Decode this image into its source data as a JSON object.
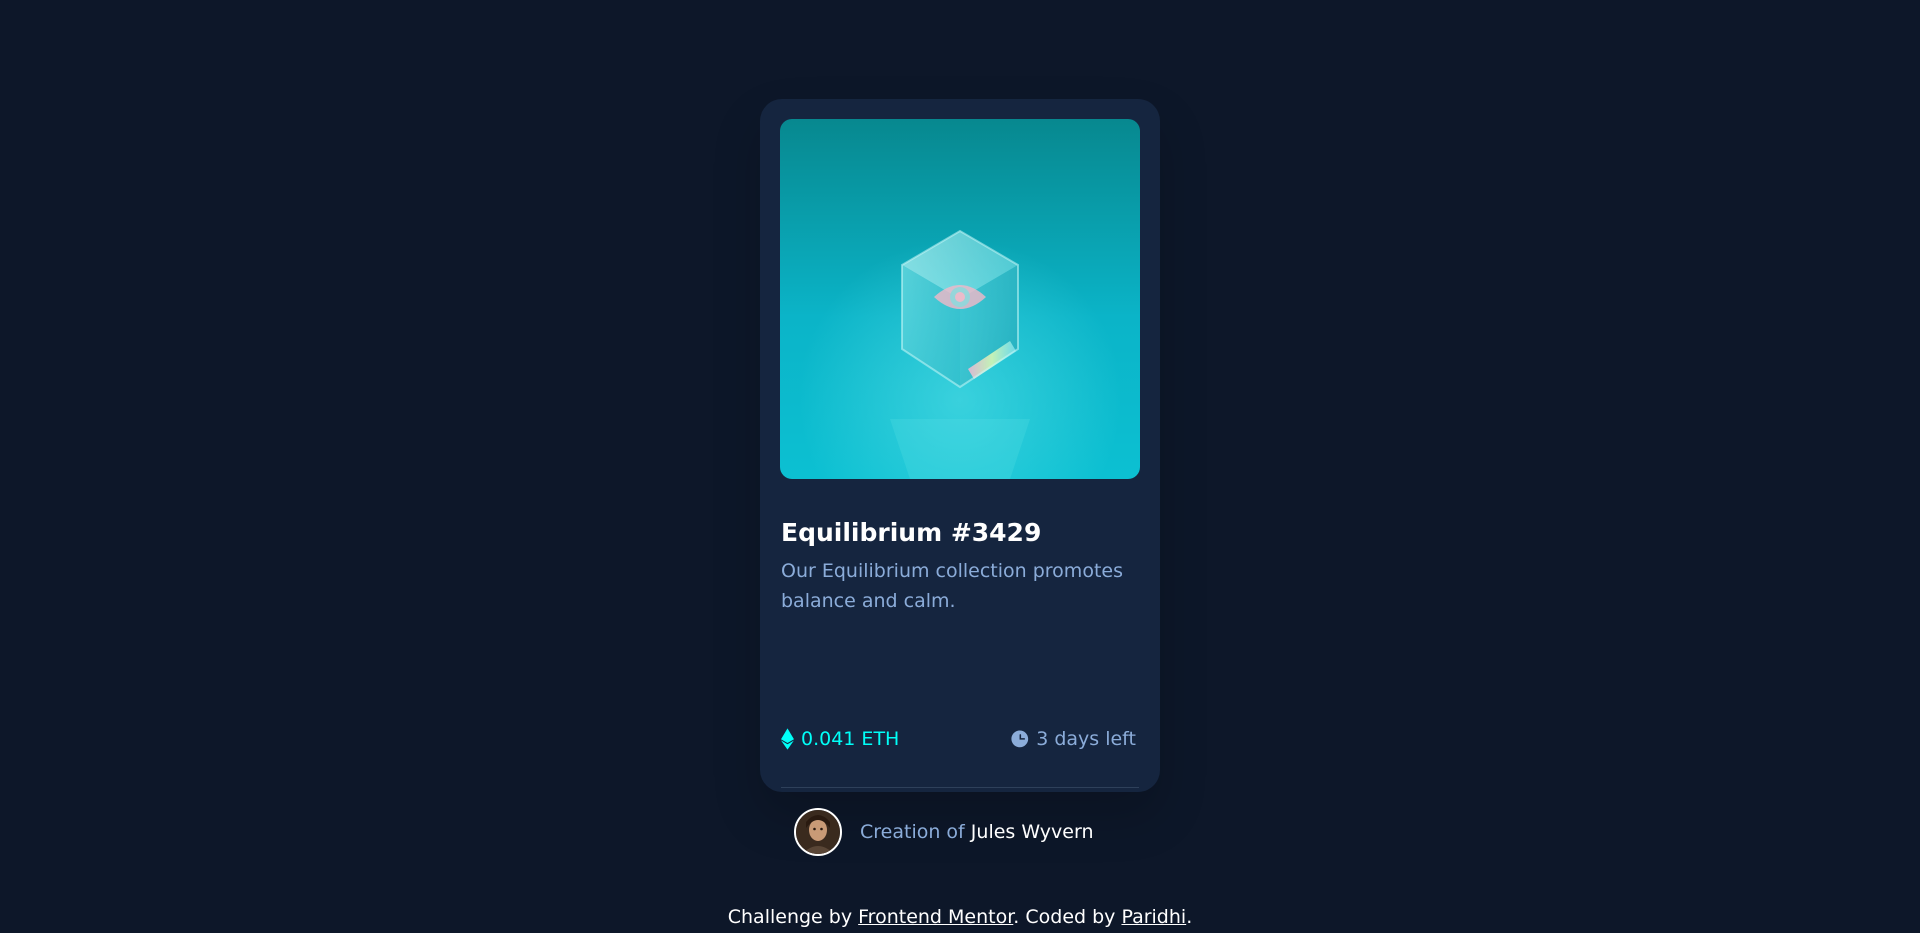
{
  "card": {
    "title": "Equilibrium #3429",
    "description": "Our Equilibrium collection promotes balance and calm.",
    "price": "0.041 ETH",
    "time_left": "3 days left",
    "creator_prefix": "Creation of",
    "creator_name": "Jules Wyvern",
    "image_icon": "eye-icon",
    "price_icon": "ethereum-icon",
    "time_icon": "clock-icon"
  },
  "footer": {
    "prefix": "Challenge by",
    "mentor_link": "Frontend Mentor",
    "middle": ". Coded by",
    "author_link": "Paridhi",
    "suffix": "."
  },
  "colors": {
    "page_background": "#0d1729",
    "card_background": "#15253f",
    "accent_cyan": "#00fff8",
    "soft_blue": "#8bacd9",
    "white": "#ffffff"
  }
}
